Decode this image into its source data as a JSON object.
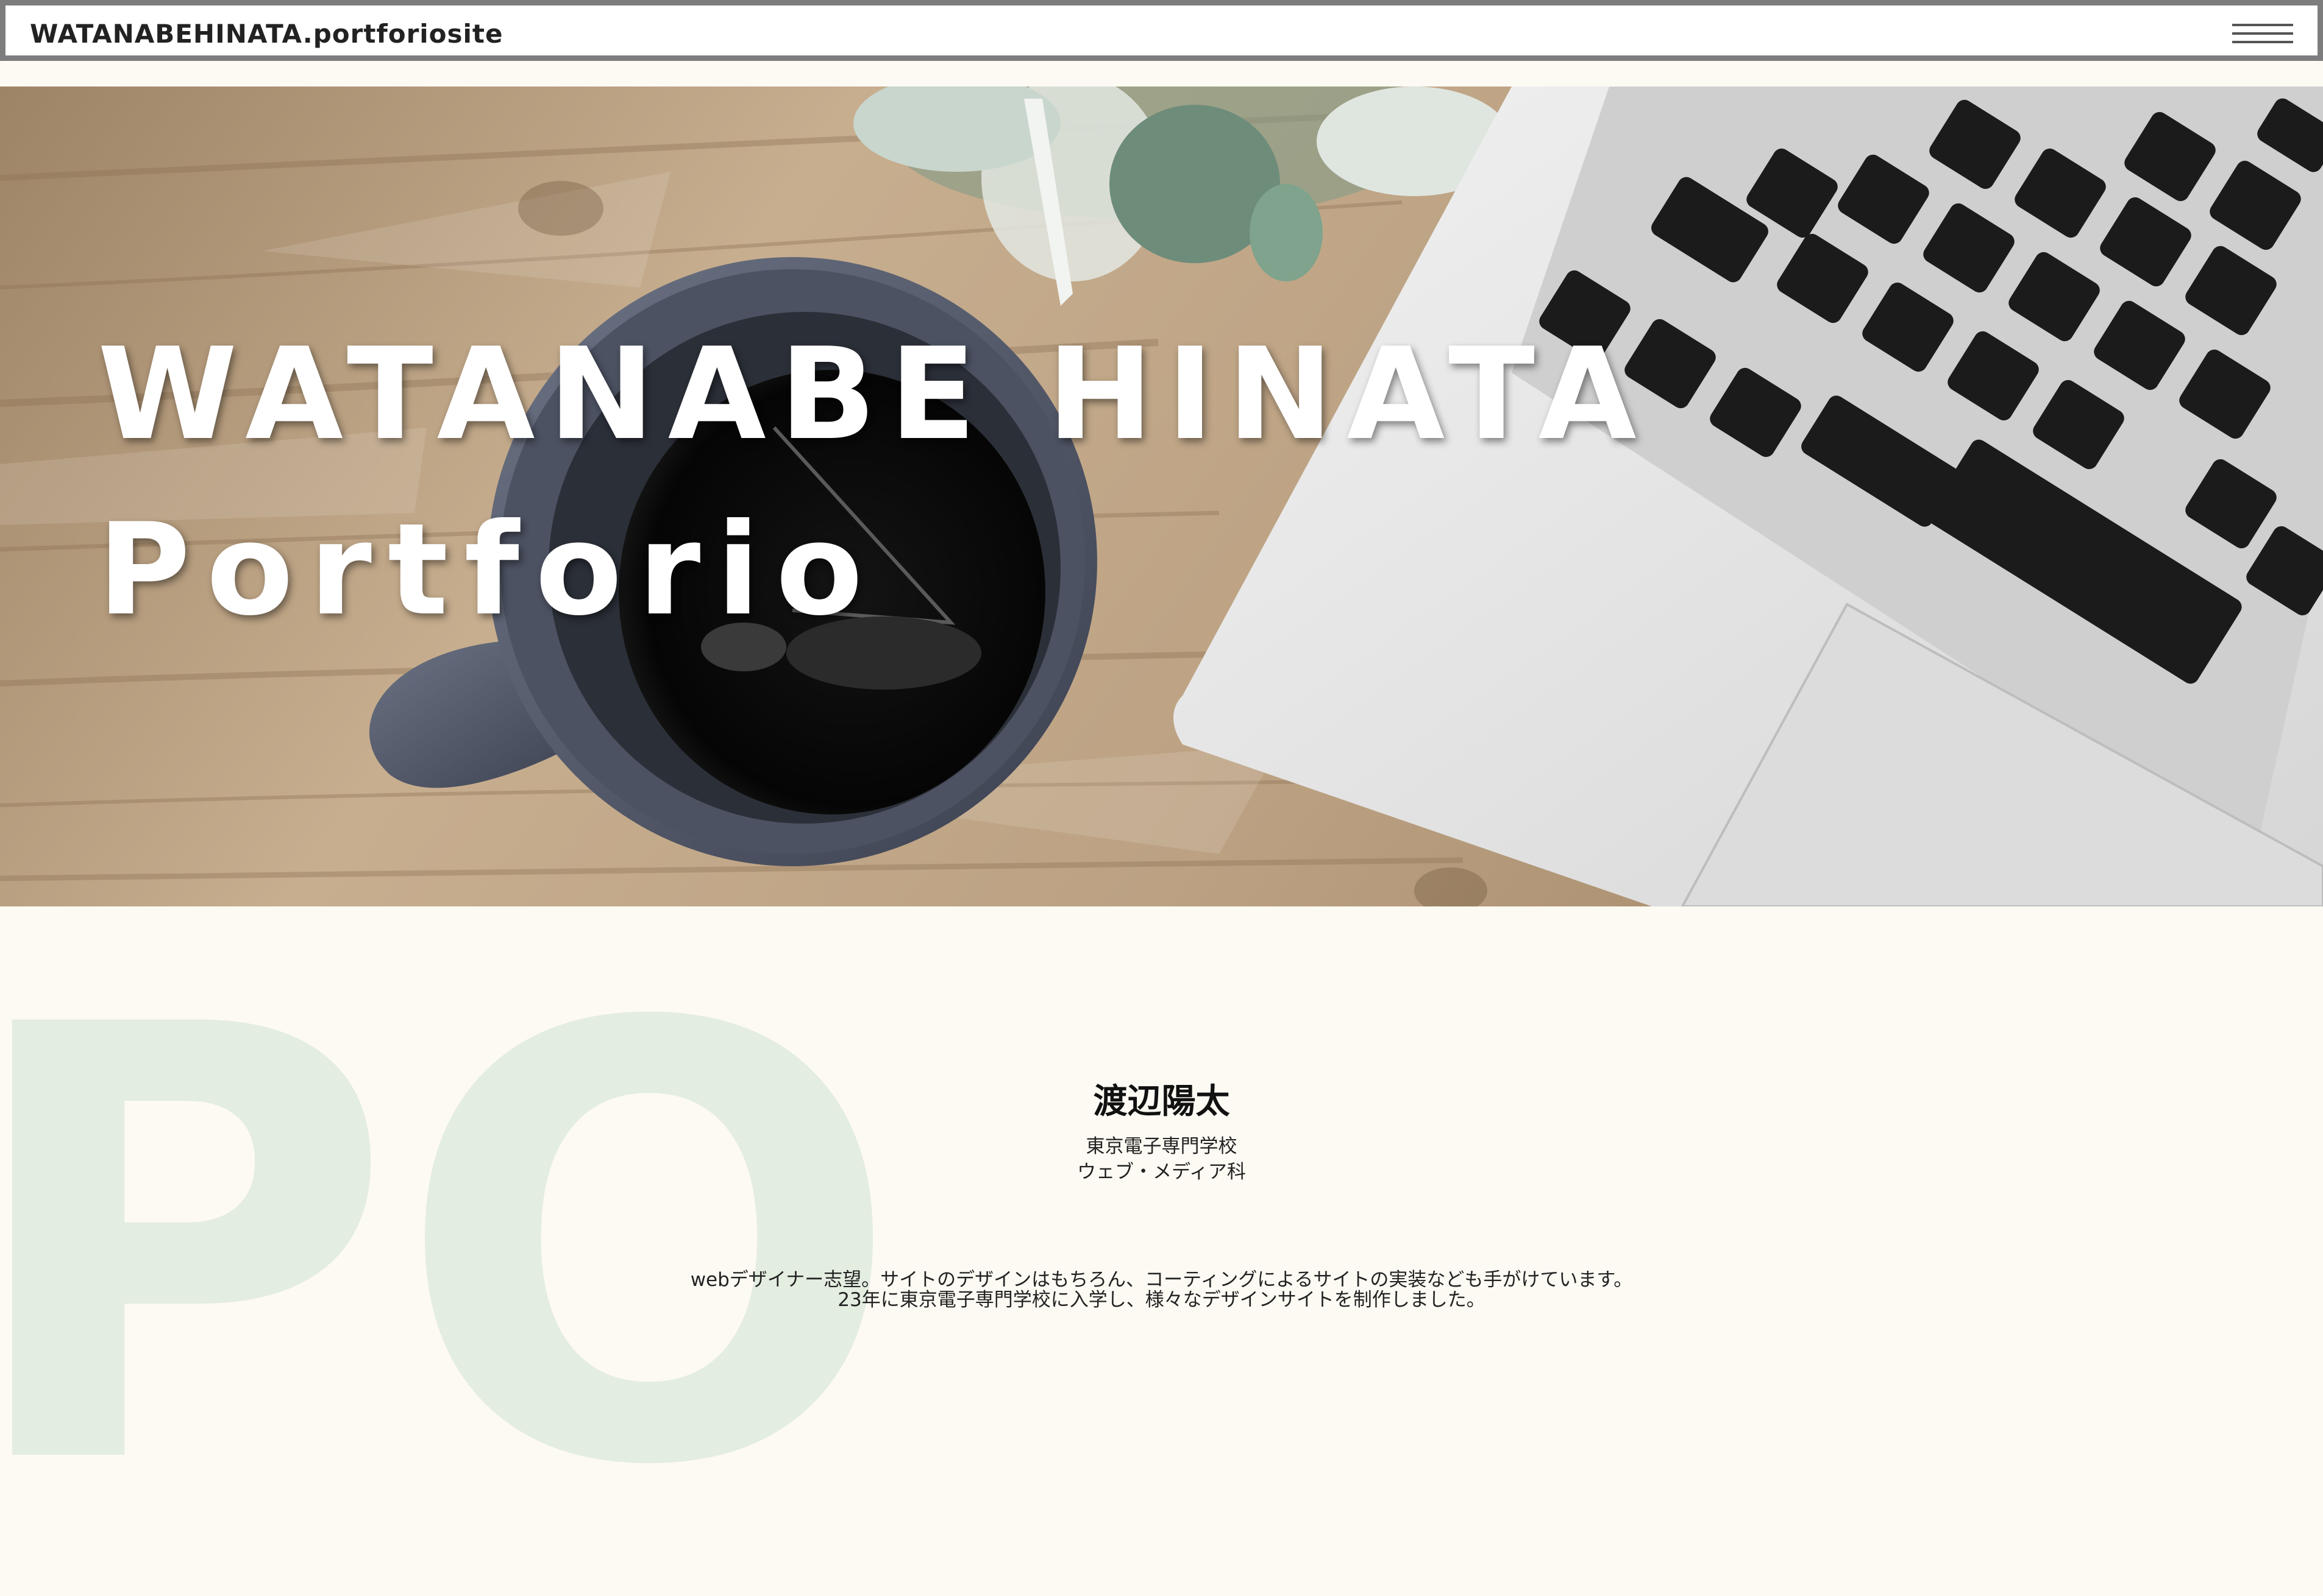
{
  "header": {
    "site_title": "WATANABEHINATA.portforiosite",
    "menu_icon": "hamburger-menu-icon"
  },
  "hero": {
    "title_line1": "WATANABE HINATA",
    "title_line2": "Portforio",
    "image": "coffee-mug-and-laptop-on-wooden-desk"
  },
  "profile": {
    "watermark": "PO",
    "name": "渡辺陽太",
    "school": "東京電子専門学校",
    "department": "ウェブ・メディア科",
    "intro_line1": "webデザイナー志望。サイトのデザインはもちろん、コーティングによるサイトの実装なども手がけています。",
    "intro_line2": "23年に東京電子専門学校に入学し、様々なデザインサイトを制作しました。"
  },
  "colors": {
    "background": "#fdfaf3",
    "header_border": "#7d7d7d",
    "watermark": "#e3ede0",
    "wood": "#b69a78"
  }
}
